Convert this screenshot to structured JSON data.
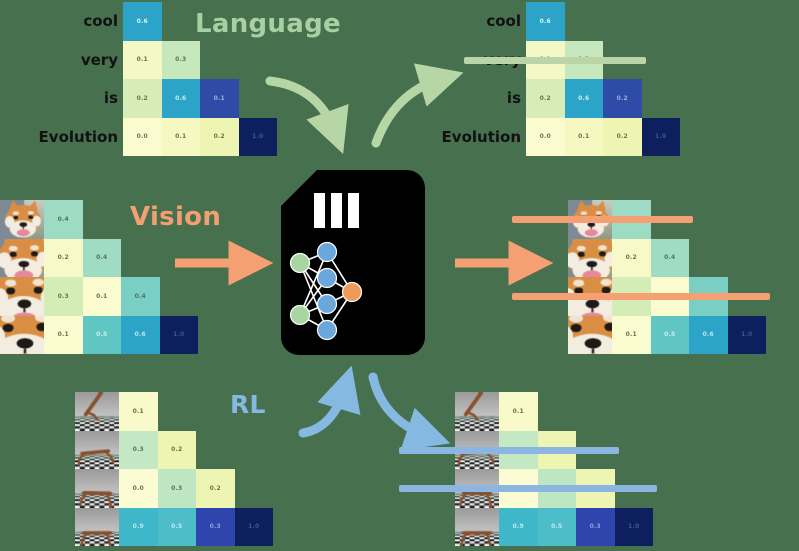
{
  "figure": {
    "background_color": "#47704f",
    "canvas_color": "#ffffff",
    "title_language": "Language",
    "title_vision": "Vision",
    "title_rl": "RL",
    "color_language": "#a9d0a2",
    "color_vision": "#f2a072",
    "color_rl": "#86b9e2"
  },
  "chip": {
    "label": "neural-network-chip",
    "body_color": "#000000",
    "input_node_color": "#a8d5a2",
    "hidden_node_color": "#6aa7db",
    "output_node_color": "#ed9a5b",
    "edge_color": "#ffffff",
    "notch_count": 3
  },
  "chart_data": [
    {
      "id": "language-input",
      "type": "heatmap",
      "title": "Language",
      "modality": "language",
      "row_labels": [
        "cool",
        "very",
        "is",
        "Evolution"
      ],
      "masked": "lower-triangular",
      "rows": [
        [
          {
            "value": "0.6",
            "color": "#2ba4c8",
            "text_color": "#dff2f7"
          }
        ],
        [
          {
            "value": "0.1",
            "color": "#f4f8c4",
            "text_color": "#6b6b4a"
          },
          {
            "value": "0.3",
            "color": "#c6e8bc",
            "text_color": "#5d7352"
          }
        ],
        [
          {
            "value": "0.2",
            "color": "#d6edb8",
            "text_color": "#64764f"
          },
          {
            "value": "0.6",
            "color": "#2ba4c8",
            "text_color": "#cfeaf2"
          },
          {
            "value": "0.1",
            "color": "#2e4ba8",
            "text_color": "#9fb0e0"
          }
        ],
        [
          {
            "value": "0.0",
            "color": "#fbfbd0",
            "text_color": "#6f6f50"
          },
          {
            "value": "0.1",
            "color": "#f6f8c2",
            "text_color": "#6d6f4b"
          },
          {
            "value": "0.2",
            "color": "#eef5b2",
            "text_color": "#6b744a"
          },
          {
            "value": "1.0",
            "color": "#0d1f5c",
            "text_color": "#44539a"
          }
        ]
      ]
    },
    {
      "id": "language-output",
      "type": "heatmap",
      "modality": "language",
      "row_labels": [
        "cool",
        "very",
        "is",
        "Evolution"
      ],
      "masked": "lower-triangular",
      "strikes": [
        {
          "row": 1,
          "color": "#bcd5a8"
        }
      ],
      "rows": [
        [
          {
            "value": "0.6",
            "color": "#2ba4c8",
            "text_color": "#dff2f7"
          }
        ],
        [
          {
            "value": "0.1",
            "color": "#f4f8c4",
            "text_color": "#6b6b4a"
          },
          {
            "value": "0.3",
            "color": "#c6e8bc",
            "text_color": "#5d7352"
          }
        ],
        [
          {
            "value": "0.2",
            "color": "#d6edb8",
            "text_color": "#64764f"
          },
          {
            "value": "0.6",
            "color": "#2ba4c8",
            "text_color": "#cfeaf2"
          },
          {
            "value": "0.2",
            "color": "#2e4ba8",
            "text_color": "#9fb0e0"
          }
        ],
        [
          {
            "value": "0.0",
            "color": "#fbfbd0",
            "text_color": "#6f6f50"
          },
          {
            "value": "0.1",
            "color": "#f6f8c2",
            "text_color": "#6d6f4b"
          },
          {
            "value": "0.2",
            "color": "#eef5b2",
            "text_color": "#6b744a"
          },
          {
            "value": "1.0",
            "color": "#0d1f5c",
            "text_color": "#44539a"
          }
        ]
      ]
    },
    {
      "id": "vision-input",
      "type": "heatmap",
      "title": "Vision",
      "modality": "vision",
      "row_thumbnails": [
        "shiba-inu-zoom-1",
        "shiba-inu-zoom-2",
        "shiba-inu-zoom-3",
        "shiba-inu-zoom-4"
      ],
      "masked": "lower-triangular",
      "rows": [
        [
          {
            "value": "0.4",
            "color": "#9ddbc4",
            "text_color": "#56705f"
          }
        ],
        [
          {
            "value": "0.2",
            "color": "#f7f9c8",
            "text_color": "#6d6f4b"
          },
          {
            "value": "0.4",
            "color": "#9fdcc3",
            "text_color": "#56705f"
          }
        ],
        [
          {
            "value": "0.3",
            "color": "#d4ecb6",
            "text_color": "#64764f"
          },
          {
            "value": "0.1",
            "color": "#fbfbd0",
            "text_color": "#6f6f50"
          },
          {
            "value": "0.4",
            "color": "#79cfc3",
            "text_color": "#4e7070"
          }
        ],
        [
          {
            "value": "0.1",
            "color": "#fbfbd0",
            "text_color": "#6f6f50"
          },
          {
            "value": "0.5",
            "color": "#5fc6c3",
            "text_color": "#cdeeeb"
          },
          {
            "value": "0.6",
            "color": "#2ba4c8",
            "text_color": "#bfe4ef"
          },
          {
            "value": "1.0",
            "color": "#0d1f5c",
            "text_color": "#44539a"
          }
        ]
      ]
    },
    {
      "id": "vision-output",
      "type": "heatmap",
      "modality": "vision",
      "row_thumbnails": [
        "shiba-inu-zoom-1",
        "shiba-inu-zoom-2",
        "shiba-inu-zoom-3",
        "shiba-inu-zoom-4"
      ],
      "masked": "lower-triangular",
      "strikes": [
        {
          "row": 0,
          "color": "#f4a072"
        },
        {
          "row": 2,
          "color": "#f4a072"
        }
      ],
      "rows": [
        [
          {
            "value": "",
            "color": "#9ddbc4",
            "text_color": "#56705f"
          }
        ],
        [
          {
            "value": "0.2",
            "color": "#f7f9c8",
            "text_color": "#6d6f4b"
          },
          {
            "value": "0.4",
            "color": "#9fdcc3",
            "text_color": "#56705f"
          }
        ],
        [
          {
            "value": "",
            "color": "#d4ecb6",
            "text_color": "#64764f"
          },
          {
            "value": "",
            "color": "#fbfbd0",
            "text_color": "#6f6f50"
          },
          {
            "value": "",
            "color": "#79cfc3",
            "text_color": "#4e7070"
          }
        ],
        [
          {
            "value": "0.1",
            "color": "#fbfbd0",
            "text_color": "#6f6f50"
          },
          {
            "value": "0.5",
            "color": "#5fc6c3",
            "text_color": "#cdeeeb"
          },
          {
            "value": "0.6",
            "color": "#2ba4c8",
            "text_color": "#bfe4ef"
          },
          {
            "value": "1.0",
            "color": "#0d1f5c",
            "text_color": "#44539a"
          }
        ]
      ]
    },
    {
      "id": "rl-input",
      "type": "heatmap",
      "title": "RL",
      "modality": "rl",
      "row_thumbnails": [
        "half-cheetah-frame-1",
        "half-cheetah-frame-2",
        "half-cheetah-frame-3",
        "half-cheetah-frame-4"
      ],
      "masked": "lower-triangular",
      "rows": [
        [
          {
            "value": "0.1",
            "color": "#f8faca",
            "text_color": "#6d6f4b"
          }
        ],
        [
          {
            "value": "0.3",
            "color": "#c4e8c4",
            "text_color": "#5d7352"
          },
          {
            "value": "0.2",
            "color": "#eef5b2",
            "text_color": "#6b744a"
          }
        ],
        [
          {
            "value": "0.0",
            "color": "#fcfcd4",
            "text_color": "#6f6f50"
          },
          {
            "value": "0.3",
            "color": "#bfe6c2",
            "text_color": "#5d7352"
          },
          {
            "value": "0.2",
            "color": "#eef5b2",
            "text_color": "#6b744a"
          }
        ],
        [
          {
            "value": "0.9",
            "color": "#3fb7cb",
            "text_color": "#bfe8ef"
          },
          {
            "value": "0.5",
            "color": "#4dbdc9",
            "text_color": "#c3e9ee"
          },
          {
            "value": "0.3",
            "color": "#2e45ad",
            "text_color": "#8fa2dc"
          },
          {
            "value": "1.0",
            "color": "#0d1f5c",
            "text_color": "#44539a"
          }
        ]
      ]
    },
    {
      "id": "rl-output",
      "type": "heatmap",
      "modality": "rl",
      "row_thumbnails": [
        "half-cheetah-frame-1",
        "half-cheetah-frame-2",
        "half-cheetah-frame-3",
        "half-cheetah-frame-4"
      ],
      "masked": "lower-triangular",
      "strikes": [
        {
          "row": 1,
          "color": "#8cb6e2"
        },
        {
          "row": 2,
          "color": "#8cb6e2"
        }
      ],
      "rows": [
        [
          {
            "value": "0.1",
            "color": "#f8faca",
            "text_color": "#6d6f4b"
          }
        ],
        [
          {
            "value": "",
            "color": "#c4e8c4",
            "text_color": "#5d7352"
          },
          {
            "value": "",
            "color": "#eef5b2",
            "text_color": "#6b744a"
          }
        ],
        [
          {
            "value": "",
            "color": "#fcfcd4",
            "text_color": "#6f6f50"
          },
          {
            "value": "",
            "color": "#bfe6c2",
            "text_color": "#5d7352"
          },
          {
            "value": "",
            "color": "#eef5b2",
            "text_color": "#6b744a"
          }
        ],
        [
          {
            "value": "0.9",
            "color": "#3fb7cb",
            "text_color": "#bfe8ef"
          },
          {
            "value": "0.5",
            "color": "#4dbdc9",
            "text_color": "#c3e9ee"
          },
          {
            "value": "0.3",
            "color": "#2e45ad",
            "text_color": "#8fa2dc"
          },
          {
            "value": "1.0",
            "color": "#0d1f5c",
            "text_color": "#44539a"
          }
        ]
      ]
    }
  ],
  "arrows": [
    {
      "name": "language-in-arrow",
      "color": "#b7d6a6"
    },
    {
      "name": "language-out-arrow",
      "color": "#b7d6a6"
    },
    {
      "name": "vision-in-arrow",
      "color": "#f4a072"
    },
    {
      "name": "vision-out-arrow",
      "color": "#f4a072"
    },
    {
      "name": "rl-in-arrow",
      "color": "#86b9e2"
    },
    {
      "name": "rl-out-arrow",
      "color": "#86b9e2"
    }
  ]
}
